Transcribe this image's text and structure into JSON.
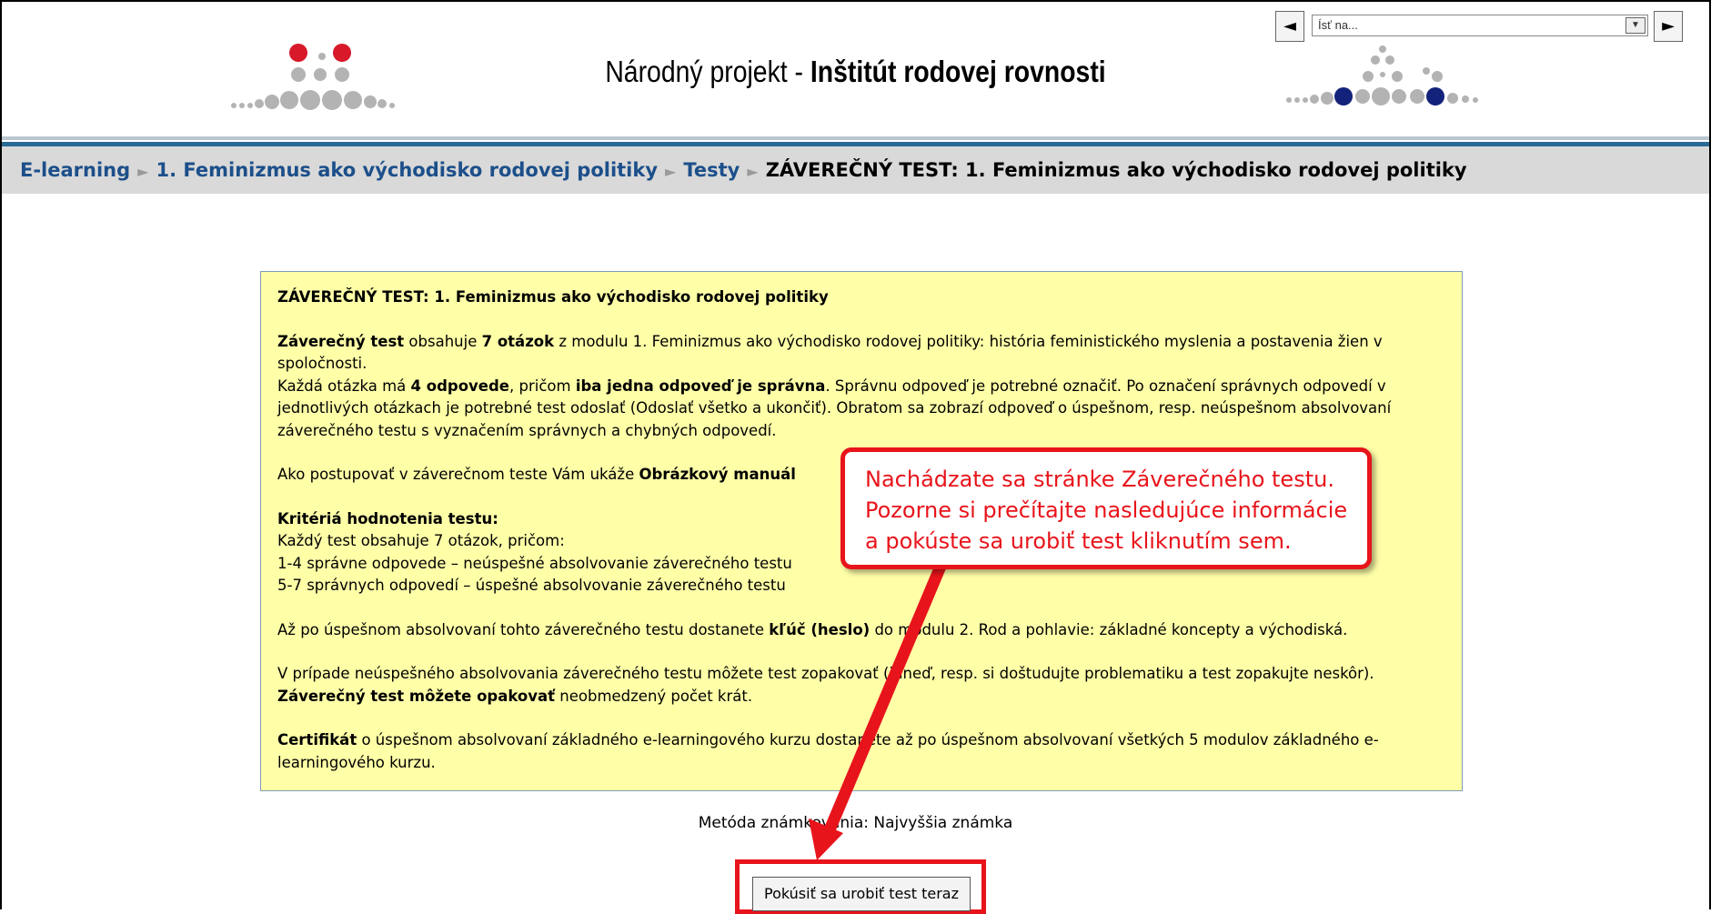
{
  "header": {
    "title_prefix": "Národný projekt - ",
    "title_bold": "Inštitút rodovej rovnosti",
    "jump": {
      "prev_symbol": "◄",
      "next_symbol": "►",
      "select_value": "Ísť na...",
      "dropdown_symbol": "▼"
    }
  },
  "breadcrumb": {
    "items": [
      "E-learning",
      "1. Feminizmus ako východisko rodovej politiky",
      "Testy"
    ],
    "separator": "►",
    "current": "ZÁVEREČNÝ TEST: 1. Feminizmus ako východisko rodovej politiky"
  },
  "intro": {
    "title": "ZÁVEREČNÝ TEST: 1. Feminizmus ako východisko rodovej politiky",
    "p1_bold1": "Záverečný test",
    "p1_t1": " obsahuje ",
    "p1_bold2": "7 otázok",
    "p1_t2": " z modulu 1. Feminizmus ako východisko rodovej politiky: história feministického myslenia a postavenia žien v spoločnosti.",
    "p2_t1": "Každá otázka má ",
    "p2_bold1": "4 odpovede",
    "p2_t2": ", pričom ",
    "p2_bold2": "iba jedna odpoveď je správna",
    "p2_t3": ". Správnu odpoveď je potrebné označiť. Po označení správnych odpovedí v jednotlivých otázkach je potrebné test odoslať (Odoslať všetko a ukončiť). Obratom sa zobrazí odpoveď o úspešnom, resp. neúspešnom absolvovaní záverečného testu s vyznačením správnych a chybných odpovedí.",
    "p3_t1": "Ako postupovať v záverečnom teste Vám ukáže ",
    "p3_bold": "Obrázkový manuál",
    "criteria_title": "Kritériá hodnotenia testu:",
    "criteria_line1": "Každý test obsahuje 7 otázok, pričom:",
    "criteria_line2": "1-4 správne odpovede – neúspešné absolvovanie záverečného testu",
    "criteria_line3": "5-7 správnych odpovedí – úspešné absolvovanie záverečného testu",
    "p5_t1": "Až po úspešnom absolvovaní tohto záverečného testu dostanete ",
    "p5_bold": "kľúč (heslo)",
    "p5_t2": " do modulu 2. Rod a pohlavie: základné koncepty a východiská.",
    "p6_t1": "V prípade neúspešného absolvovania záverečného testu môžete test zopakovať (ihneď, resp. si doštudujte problematiku a test zopakujte neskôr).",
    "p6_bold": "Záverečný test môžete opakovať",
    "p6_t2": " neobmedzený počet krát.",
    "p7_bold": "Certifikát",
    "p7_t1": " o úspešnom absolvovaní základného e-learningového kurzu dostanete až po úspešnom absolvovaní všetkých 5 modulov základného e-learningového kurzu."
  },
  "grading": "Metóda známkovania: Najvyššia známka",
  "attempt_button": "Pokúsiť sa urobiť test teraz",
  "callout": {
    "line1": "Nachádzate sa stránke Záverečného testu.",
    "line2": "Pozorne si prečítajte nasledujúce informácie",
    "line3": "a pokúste sa urobiť test kliknutím sem."
  },
  "colors": {
    "annotation_red": "#e8141b",
    "logo_red": "#d7192a",
    "logo_gray": "#b3b3b3",
    "logo_navy": "#13227a",
    "breadcrumb_link": "#1c4f8a",
    "nav_bar": "#d9d9d9",
    "intro_bg": "#ffffa8"
  },
  "icons": {
    "left_logo": "dot-pyramid-logo-red",
    "right_logo": "dot-pyramid-logo-navy"
  }
}
